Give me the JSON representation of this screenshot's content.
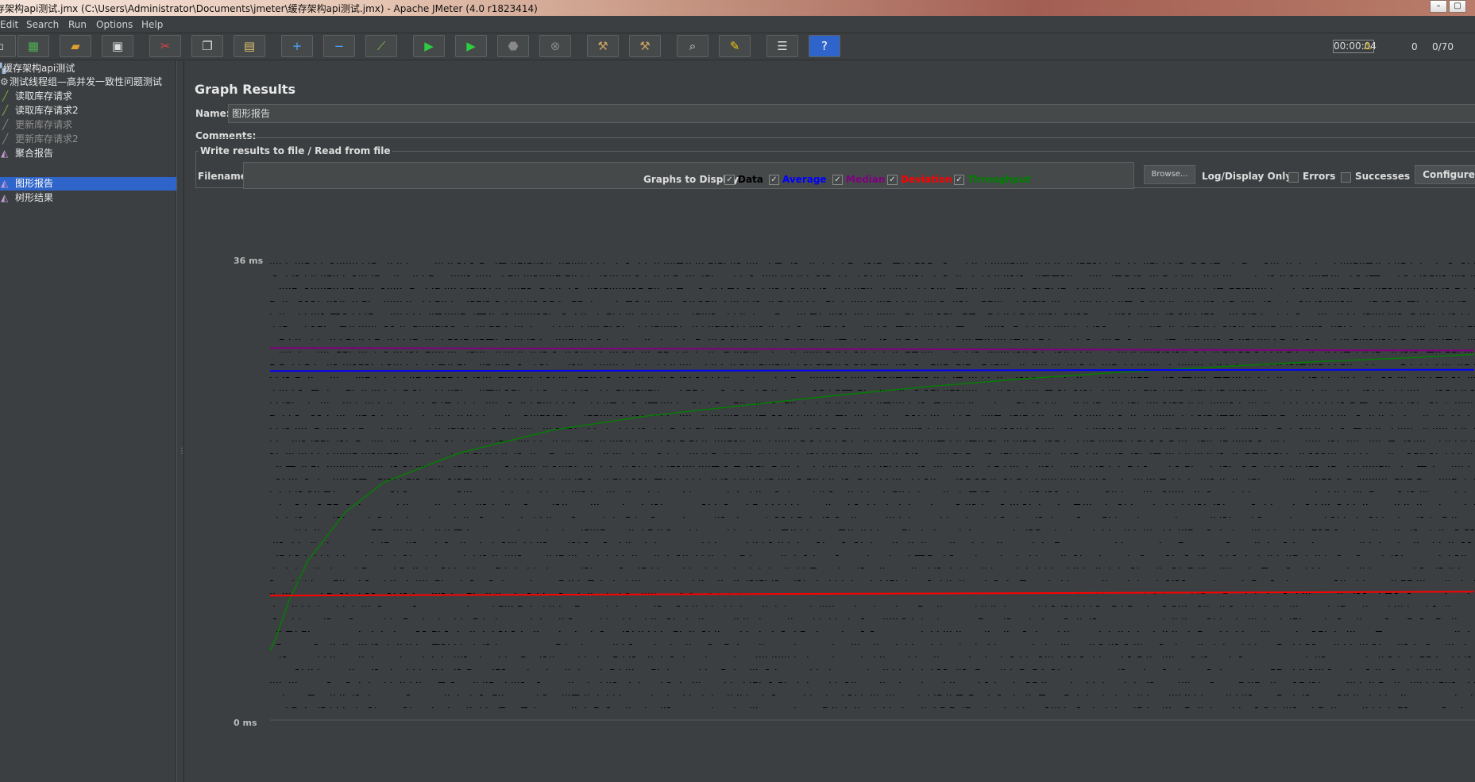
{
  "window": {
    "title": "存架构api测试.jmx (C:\\Users\\Administrator\\Documents\\jmeter\\缓存架构api测试.jmx) - Apache JMeter (4.0 r1823414)"
  },
  "menu": [
    "Edit",
    "Search",
    "Run",
    "Options",
    "Help"
  ],
  "toolbar": {
    "icons": [
      "new-icon",
      "templates-icon",
      "open-icon",
      "save-icon",
      "cut-icon",
      "copy-icon",
      "paste-icon",
      "expand-icon",
      "collapse-icon",
      "toggle-icon",
      "start-icon",
      "start-no-pause-icon",
      "stop-icon",
      "shutdown-icon",
      "clear-icon",
      "clear-all-icon",
      "search-icon",
      "reset-search-icon",
      "function-helper-icon",
      "help-icon"
    ],
    "timer": "00:00:04",
    "warnings": "0",
    "threads": "0/70"
  },
  "tree": [
    {
      "label": "缓存架构api测试",
      "icon": "testplan-icon",
      "level": 0,
      "selected": false,
      "disabled": false
    },
    {
      "label": "测试线程组—高并发一致性问题测试",
      "icon": "gear-icon",
      "level": 1,
      "selected": false,
      "disabled": false
    },
    {
      "label": "读取库存请求",
      "icon": "sampler-icon",
      "level": 2,
      "selected": false,
      "disabled": false
    },
    {
      "label": "读取库存请求2",
      "icon": "sampler-icon",
      "level": 2,
      "selected": false,
      "disabled": false
    },
    {
      "label": "更新库存请求",
      "icon": "sampler-icon",
      "level": 2,
      "selected": false,
      "disabled": true
    },
    {
      "label": "更新库存请求2",
      "icon": "sampler-icon",
      "level": 2,
      "selected": false,
      "disabled": true
    },
    {
      "label": "聚合报告",
      "icon": "listener-icon",
      "level": 2,
      "selected": false,
      "disabled": false
    },
    {
      "label": "图形报告",
      "icon": "listener-icon",
      "level": 2,
      "selected": true,
      "disabled": false
    },
    {
      "label": "树形结果",
      "icon": "listener-icon",
      "level": 2,
      "selected": false,
      "disabled": false
    }
  ],
  "panel": {
    "title": "Graph Results",
    "name_label": "Name:",
    "name_value": "图形报告",
    "comments_label": "Comments:",
    "file_legend": "Write results to file / Read from file",
    "filename_label": "Filename",
    "filename_value": "",
    "browse_label": "Browse...",
    "log_display_label": "Log/Display Only:",
    "errors_label": "Errors",
    "successes_label": "Successes",
    "configure_label": "Configure"
  },
  "graphs_to_display": {
    "label": "Graphs to Display",
    "items": [
      {
        "label": "Data",
        "checked": true,
        "color": "#000000"
      },
      {
        "label": "Average",
        "checked": true,
        "color": "#0000ff"
      },
      {
        "label": "Median",
        "checked": true,
        "color": "#800080"
      },
      {
        "label": "Deviation",
        "checked": true,
        "color": "#ff0000"
      },
      {
        "label": "Throughput",
        "checked": true,
        "color": "#008000"
      }
    ]
  },
  "graph": {
    "y_max_label": "36  ms",
    "y_min_label": "0  ms"
  },
  "chart_data": {
    "type": "line",
    "title": "",
    "xlabel": "",
    "ylabel": "ms",
    "ylim": [
      0,
      36
    ],
    "series": [
      {
        "name": "Throughput",
        "color": "#008000",
        "x": [
          0,
          5,
          10,
          20,
          40,
          80,
          120,
          200,
          300,
          400,
          500,
          600,
          700,
          800,
          900,
          1000,
          1100,
          1200,
          1276
        ],
        "y": [
          5.4,
          6.2,
          7.2,
          9.3,
          12.4,
          16.2,
          18.5,
          20.8,
          22.6,
          23.7,
          24.5,
          25.3,
          26.0,
          26.6,
          27.1,
          27.5,
          27.9,
          28.2,
          28.5
        ]
      },
      {
        "name": "Average",
        "color": "#0000ff",
        "x": [
          0,
          1276
        ],
        "y": [
          27.2,
          27.3
        ]
      },
      {
        "name": "Median",
        "color": "#800080",
        "x": [
          0,
          1276
        ],
        "y": [
          29.0,
          28.8
        ]
      },
      {
        "name": "Deviation",
        "color": "#ff0000",
        "x": [
          0,
          1276
        ],
        "y": [
          9.7,
          10.0
        ]
      }
    ]
  }
}
